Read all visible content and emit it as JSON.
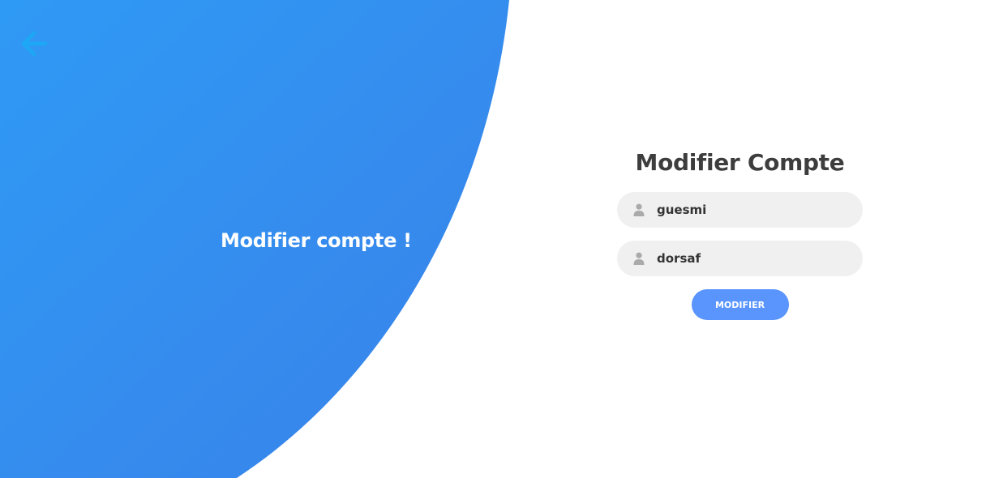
{
  "colors": {
    "panel_gradient_start": "#2f9af5",
    "panel_gradient_end": "#3a81e8",
    "back_arrow": "#1da7f4",
    "button": "#5995fd",
    "field_bg": "#f0f0f0",
    "title_text": "#3d3d3d"
  },
  "back": {
    "icon": "arrow-left-icon"
  },
  "left_panel": {
    "title": "Modifier compte !"
  },
  "form": {
    "title": "Modifier Compte",
    "fields": [
      {
        "icon": "user-icon",
        "value": "guesmi"
      },
      {
        "icon": "user-icon",
        "value": "dorsaf"
      }
    ],
    "submit_label": "MODIFIER"
  }
}
